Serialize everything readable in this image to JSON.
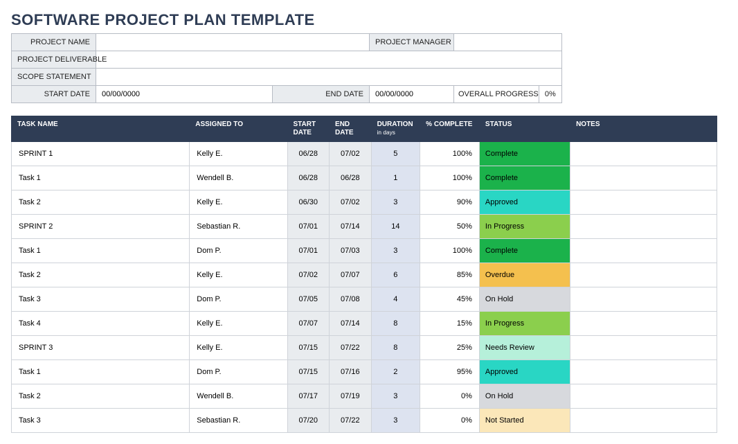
{
  "title": "SOFTWARE PROJECT PLAN TEMPLATE",
  "meta": {
    "labels": {
      "project_name": "PROJECT NAME",
      "project_manager": "PROJECT MANAGER",
      "project_deliverable": "PROJECT DELIVERABLE",
      "scope_statement": "SCOPE STATEMENT",
      "start_date": "START DATE",
      "end_date": "END DATE",
      "overall_progress": "OVERALL PROGRESS"
    },
    "values": {
      "project_name": "",
      "project_manager": "",
      "project_deliverable": "",
      "scope_statement": "",
      "start_date": "00/00/0000",
      "end_date": "00/00/0000",
      "overall_progress": "0%"
    }
  },
  "columns": {
    "task": "TASK NAME",
    "assigned": "ASSIGNED TO",
    "start": "START DATE",
    "end": "END DATE",
    "duration": "DURATION",
    "duration_sub": "in days",
    "pct": "% COMPLETE",
    "status": "STATUS",
    "notes": "NOTES"
  },
  "status_classes": {
    "Complete": "s-complete",
    "Approved": "s-approved",
    "In Progress": "s-inprogress",
    "Overdue": "s-overdue",
    "On Hold": "s-onhold",
    "Needs Review": "s-needsreview",
    "Not Started": "s-notstarted"
  },
  "rows": [
    {
      "task": "SPRINT 1",
      "assigned": "Kelly E.",
      "start": "06/28",
      "end": "07/02",
      "duration": "5",
      "pct": "100%",
      "status": "Complete",
      "notes": ""
    },
    {
      "task": "Task 1",
      "assigned": "Wendell B.",
      "start": "06/28",
      "end": "06/28",
      "duration": "1",
      "pct": "100%",
      "status": "Complete",
      "notes": ""
    },
    {
      "task": "Task 2",
      "assigned": "Kelly E.",
      "start": "06/30",
      "end": "07/02",
      "duration": "3",
      "pct": "90%",
      "status": "Approved",
      "notes": ""
    },
    {
      "task": "SPRINT 2",
      "assigned": "Sebastian R.",
      "start": "07/01",
      "end": "07/14",
      "duration": "14",
      "pct": "50%",
      "status": "In Progress",
      "notes": ""
    },
    {
      "task": "Task 1",
      "assigned": "Dom P.",
      "start": "07/01",
      "end": "07/03",
      "duration": "3",
      "pct": "100%",
      "status": "Complete",
      "notes": ""
    },
    {
      "task": "Task 2",
      "assigned": "Kelly E.",
      "start": "07/02",
      "end": "07/07",
      "duration": "6",
      "pct": "85%",
      "status": "Overdue",
      "notes": ""
    },
    {
      "task": "Task 3",
      "assigned": "Dom P.",
      "start": "07/05",
      "end": "07/08",
      "duration": "4",
      "pct": "45%",
      "status": "On Hold",
      "notes": ""
    },
    {
      "task": "Task 4",
      "assigned": "Kelly E.",
      "start": "07/07",
      "end": "07/14",
      "duration": "8",
      "pct": "15%",
      "status": "In Progress",
      "notes": ""
    },
    {
      "task": "SPRINT 3",
      "assigned": "Kelly E.",
      "start": "07/15",
      "end": "07/22",
      "duration": "8",
      "pct": "25%",
      "status": "Needs Review",
      "notes": ""
    },
    {
      "task": "Task 1",
      "assigned": "Dom P.",
      "start": "07/15",
      "end": "07/16",
      "duration": "2",
      "pct": "95%",
      "status": "Approved",
      "notes": ""
    },
    {
      "task": "Task 2",
      "assigned": "Wendell B.",
      "start": "07/17",
      "end": "07/19",
      "duration": "3",
      "pct": "0%",
      "status": "On Hold",
      "notes": ""
    },
    {
      "task": "Task 3",
      "assigned": "Sebastian R.",
      "start": "07/20",
      "end": "07/22",
      "duration": "3",
      "pct": "0%",
      "status": "Not Started",
      "notes": ""
    }
  ]
}
